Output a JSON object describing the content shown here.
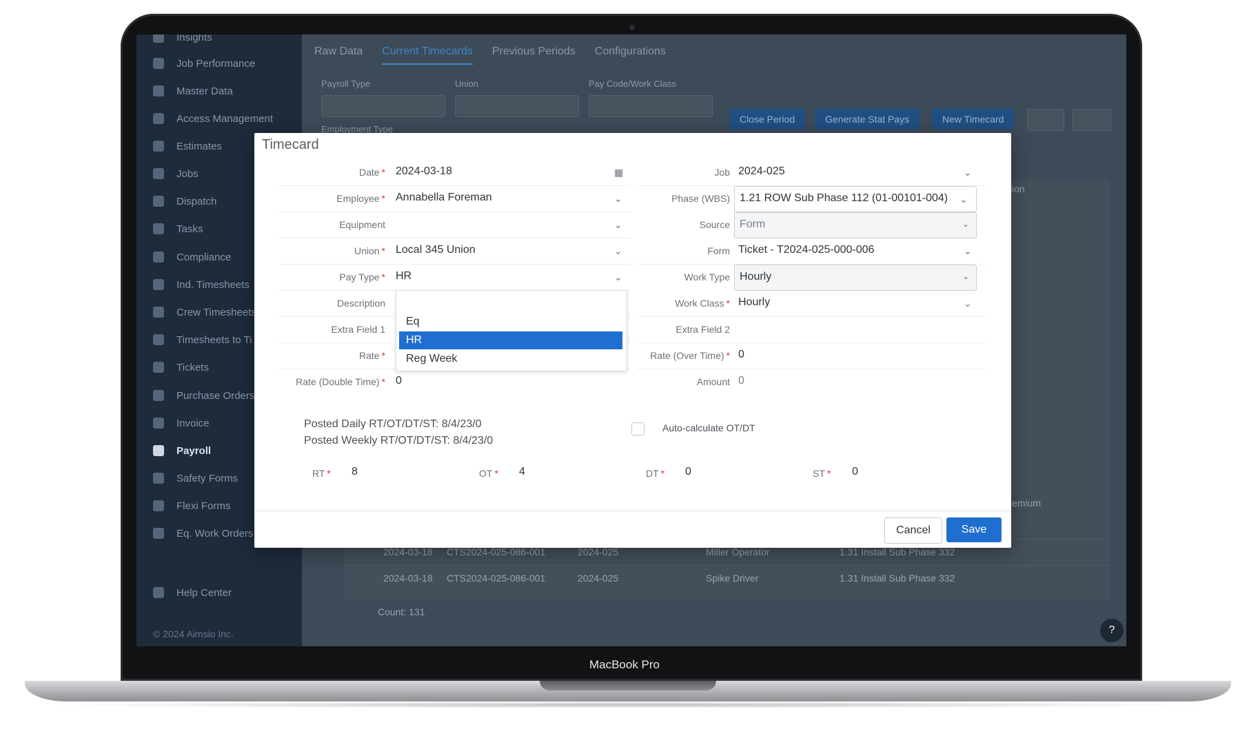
{
  "device_label": "MacBook Pro",
  "sidebar": {
    "items": [
      {
        "label": "Insights"
      },
      {
        "label": "Job Performance"
      },
      {
        "label": "Master Data"
      },
      {
        "label": "Access Management"
      },
      {
        "label": "Estimates"
      },
      {
        "label": "Jobs"
      },
      {
        "label": "Dispatch"
      },
      {
        "label": "Tasks"
      },
      {
        "label": "Compliance"
      },
      {
        "label": "Ind. Timesheets"
      },
      {
        "label": "Crew Timesheets"
      },
      {
        "label": "Timesheets to Ti"
      },
      {
        "label": "Tickets"
      },
      {
        "label": "Purchase Orders"
      },
      {
        "label": "Invoice"
      },
      {
        "label": "Payroll"
      },
      {
        "label": "Safety Forms"
      },
      {
        "label": "Flexi Forms"
      },
      {
        "label": "Eq. Work Orders"
      }
    ],
    "help": "Help Center",
    "copyright": "© 2024 Aimsio Inc."
  },
  "tabs": [
    "Raw Data",
    "Current Timecards",
    "Previous Periods",
    "Configurations"
  ],
  "filters": {
    "payroll_type": "Payroll Type",
    "union": "Union",
    "pay_code": "Pay Code/Work Class",
    "employment_type": "Employment Type"
  },
  "toolbar": {
    "close_period": "Close Period",
    "generate_stat_pays": "Generate Stat Pays",
    "new_timecard": "New Timecard"
  },
  "grid": {
    "header_partial": "tion",
    "premium_partial": "emium",
    "rows": [
      {
        "date": "2024-03-18",
        "ticket": "CTS2024-025-086-001",
        "job": "2024-025",
        "employee": "Miller Operator",
        "phase": "1.31 Install Sub Phase 332"
      },
      {
        "date": "2024-03-18",
        "ticket": "CTS2024-025-086-001",
        "job": "2024-025",
        "employee": "Spike Driver",
        "phase": "1.31 Install Sub Phase 332"
      }
    ],
    "count": "Count: 131"
  },
  "modal": {
    "title": "Timecard",
    "left": {
      "date": {
        "label": "Date",
        "value": "2024-03-18"
      },
      "employee": {
        "label": "Employee",
        "value": "Annabella Foreman"
      },
      "equipment": {
        "label": "Equipment",
        "value": ""
      },
      "union": {
        "label": "Union",
        "value": "Local 345 Union"
      },
      "pay_type": {
        "label": "Pay Type",
        "value": "HR"
      },
      "description": {
        "label": "Description"
      },
      "extra_field_1": {
        "label": "Extra Field 1"
      },
      "rate": {
        "label": "Rate"
      },
      "rate_double": {
        "label": "Rate (Double Time)",
        "value": "0"
      }
    },
    "right": {
      "job": {
        "label": "Job",
        "value": "2024-025"
      },
      "phase": {
        "label": "Phase (WBS)",
        "value": "1.21 ROW Sub Phase 112 (01-00101-004)"
      },
      "source": {
        "label": "Source",
        "value": "Form"
      },
      "form": {
        "label": "Form",
        "value": "Ticket - T2024-025-000-006"
      },
      "work_type": {
        "label": "Work Type",
        "value": "Hourly"
      },
      "work_class": {
        "label": "Work Class",
        "value": "Hourly"
      },
      "extra_field_2": {
        "label": "Extra Field 2"
      },
      "rate_ot": {
        "label": "Rate (Over Time)",
        "value": "0"
      },
      "amount": {
        "label": "Amount",
        "value": "0"
      }
    },
    "pay_type_options": [
      "Eq",
      "HR",
      "Reg Week"
    ],
    "posted_daily": "Posted Daily RT/OT/DT/ST: 8/4/23/0",
    "posted_weekly": "Posted Weekly RT/OT/DT/ST: 8/4/23/0",
    "auto_calc_label": "Auto-calculate OT/DT",
    "hours": {
      "rt": {
        "label": "RT",
        "value": "8"
      },
      "ot": {
        "label": "OT",
        "value": "4"
      },
      "dt": {
        "label": "DT",
        "value": "0"
      },
      "st": {
        "label": "ST",
        "value": "0"
      }
    },
    "cancel": "Cancel",
    "save": "Save"
  },
  "colors": {
    "primary": "#1f6fd1",
    "required": "#e0313b",
    "sidebar_bg": "#1e2b3b"
  }
}
